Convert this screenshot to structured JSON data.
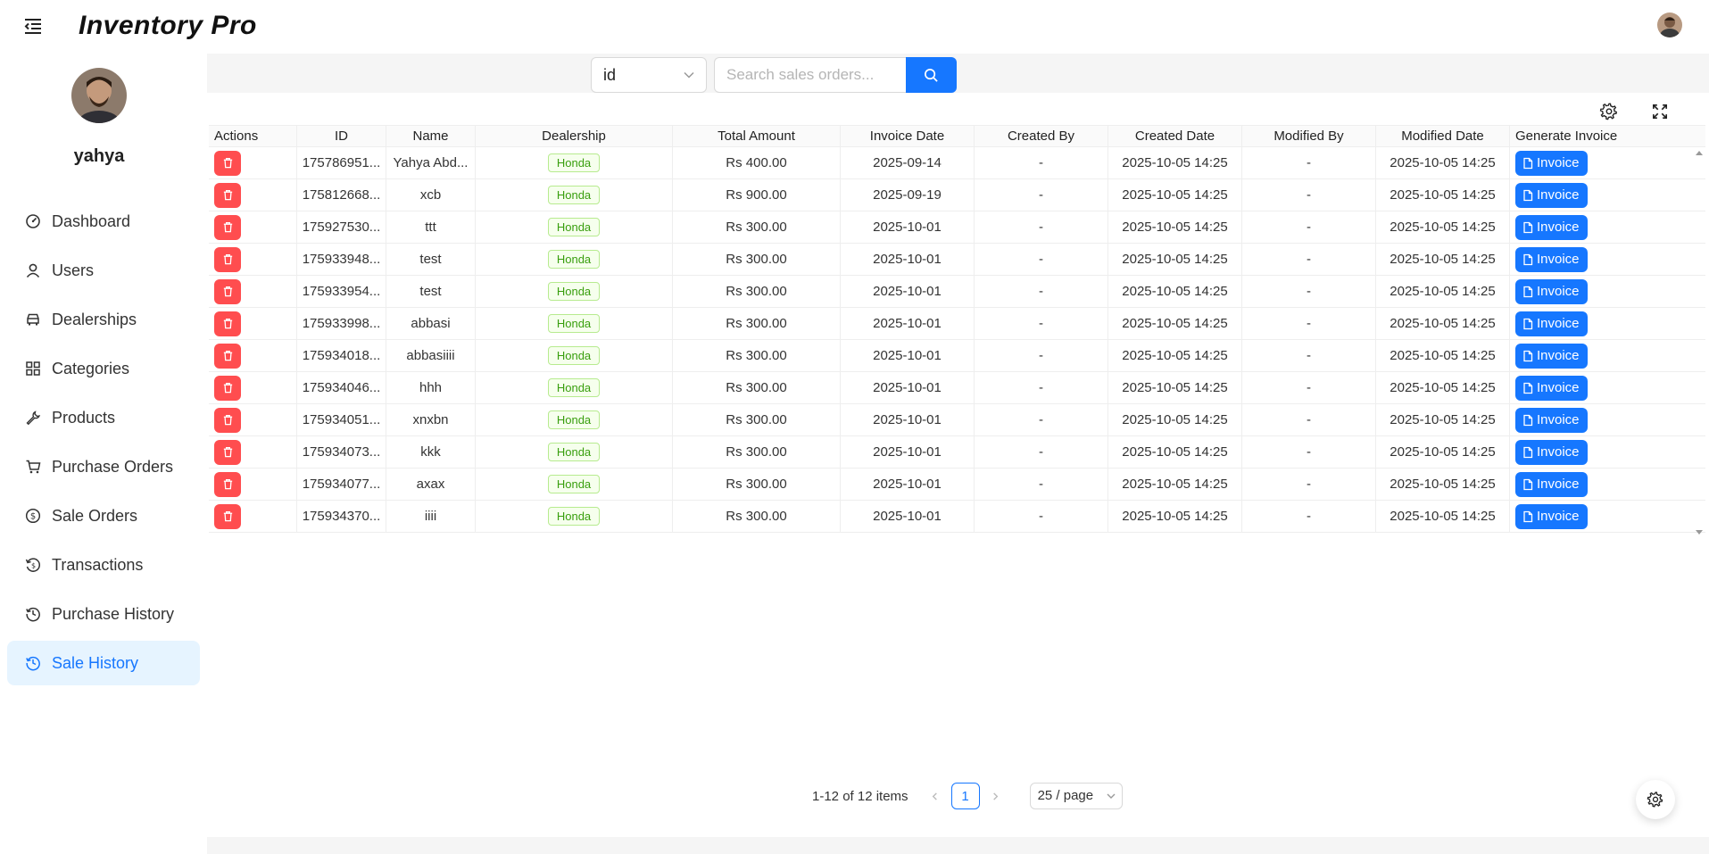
{
  "app": {
    "title": "Inventory Pro"
  },
  "user": {
    "name": "yahya"
  },
  "sidebar": {
    "items": [
      {
        "label": "Dashboard",
        "icon": "dashboard-icon"
      },
      {
        "label": "Users",
        "icon": "user-icon"
      },
      {
        "label": "Dealerships",
        "icon": "car-icon"
      },
      {
        "label": "Categories",
        "icon": "grid-icon"
      },
      {
        "label": "Products",
        "icon": "wrench-icon"
      },
      {
        "label": "Purchase Orders",
        "icon": "cart-icon"
      },
      {
        "label": "Sale Orders",
        "icon": "dollar-icon"
      },
      {
        "label": "Transactions",
        "icon": "transaction-icon"
      },
      {
        "label": "Purchase History",
        "icon": "history-icon"
      },
      {
        "label": "Sale History",
        "icon": "history-icon",
        "active": true
      }
    ]
  },
  "search": {
    "field_value": "id",
    "placeholder": "Search sales orders..."
  },
  "table": {
    "columns": [
      "Actions",
      "ID",
      "Name",
      "Dealership",
      "Total Amount",
      "Invoice Date",
      "Created By",
      "Created Date",
      "Modified By",
      "Modified Date",
      "Generate Invoice"
    ],
    "rows": [
      {
        "id": "175786951...",
        "name": "Yahya Abd...",
        "dealership": "Honda",
        "total": "Rs 400.00",
        "invoice_date": "2025-09-14",
        "created_by": "-",
        "created_date": "2025-10-05 14:25",
        "modified_by": "-",
        "modified_date": "2025-10-05 14:25",
        "action": "Invoice"
      },
      {
        "id": "175812668...",
        "name": "xcb",
        "dealership": "Honda",
        "total": "Rs 900.00",
        "invoice_date": "2025-09-19",
        "created_by": "-",
        "created_date": "2025-10-05 14:25",
        "modified_by": "-",
        "modified_date": "2025-10-05 14:25",
        "action": "Invoice"
      },
      {
        "id": "175927530...",
        "name": "ttt",
        "dealership": "Honda",
        "total": "Rs 300.00",
        "invoice_date": "2025-10-01",
        "created_by": "-",
        "created_date": "2025-10-05 14:25",
        "modified_by": "-",
        "modified_date": "2025-10-05 14:25",
        "action": "Invoice"
      },
      {
        "id": "175933948...",
        "name": "test",
        "dealership": "Honda",
        "total": "Rs 300.00",
        "invoice_date": "2025-10-01",
        "created_by": "-",
        "created_date": "2025-10-05 14:25",
        "modified_by": "-",
        "modified_date": "2025-10-05 14:25",
        "action": "Invoice"
      },
      {
        "id": "175933954...",
        "name": "test",
        "dealership": "Honda",
        "total": "Rs 300.00",
        "invoice_date": "2025-10-01",
        "created_by": "-",
        "created_date": "2025-10-05 14:25",
        "modified_by": "-",
        "modified_date": "2025-10-05 14:25",
        "action": "Invoice"
      },
      {
        "id": "175933998...",
        "name": "abbasi",
        "dealership": "Honda",
        "total": "Rs 300.00",
        "invoice_date": "2025-10-01",
        "created_by": "-",
        "created_date": "2025-10-05 14:25",
        "modified_by": "-",
        "modified_date": "2025-10-05 14:25",
        "action": "Invoice"
      },
      {
        "id": "175934018...",
        "name": "abbasiiii",
        "dealership": "Honda",
        "total": "Rs 300.00",
        "invoice_date": "2025-10-01",
        "created_by": "-",
        "created_date": "2025-10-05 14:25",
        "modified_by": "-",
        "modified_date": "2025-10-05 14:25",
        "action": "Invoice"
      },
      {
        "id": "175934046...",
        "name": "hhh",
        "dealership": "Honda",
        "total": "Rs 300.00",
        "invoice_date": "2025-10-01",
        "created_by": "-",
        "created_date": "2025-10-05 14:25",
        "modified_by": "-",
        "modified_date": "2025-10-05 14:25",
        "action": "Invoice"
      },
      {
        "id": "175934051...",
        "name": "xnxbn",
        "dealership": "Honda",
        "total": "Rs 300.00",
        "invoice_date": "2025-10-01",
        "created_by": "-",
        "created_date": "2025-10-05 14:25",
        "modified_by": "-",
        "modified_date": "2025-10-05 14:25",
        "action": "Invoice"
      },
      {
        "id": "175934073...",
        "name": "kkk",
        "dealership": "Honda",
        "total": "Rs 300.00",
        "invoice_date": "2025-10-01",
        "created_by": "-",
        "created_date": "2025-10-05 14:25",
        "modified_by": "-",
        "modified_date": "2025-10-05 14:25",
        "action": "Invoice"
      },
      {
        "id": "175934077...",
        "name": "axax",
        "dealership": "Honda",
        "total": "Rs 300.00",
        "invoice_date": "2025-10-01",
        "created_by": "-",
        "created_date": "2025-10-05 14:25",
        "modified_by": "-",
        "modified_date": "2025-10-05 14:25",
        "action": "Invoice"
      },
      {
        "id": "175934370...",
        "name": "iiii",
        "dealership": "Honda",
        "total": "Rs 300.00",
        "invoice_date": "2025-10-01",
        "created_by": "-",
        "created_date": "2025-10-05 14:25",
        "modified_by": "-",
        "modified_date": "2025-10-05 14:25",
        "action": "Invoice"
      }
    ]
  },
  "pagination": {
    "total_text": "1-12 of 12 items",
    "current_page": "1",
    "page_size": "25 / page"
  },
  "colors": {
    "accent": "#1677ff",
    "danger": "#ff4d4f",
    "tag_green": "#389e0d"
  }
}
